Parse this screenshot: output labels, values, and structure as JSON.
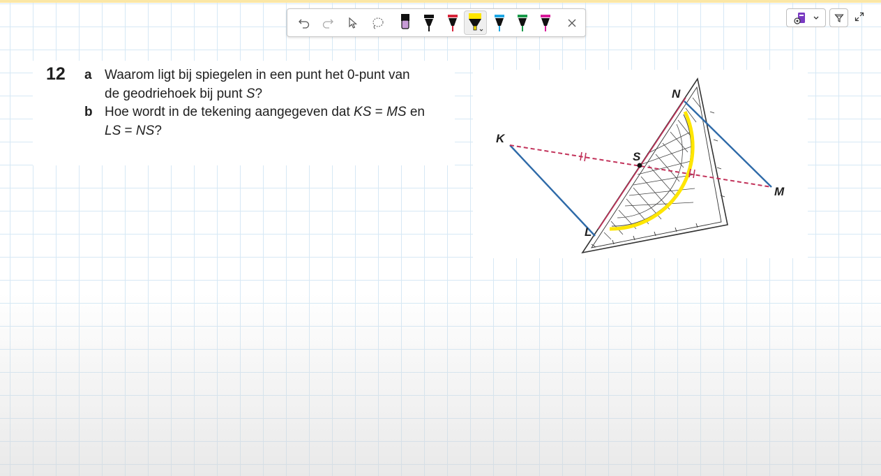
{
  "colors": {
    "grid_line": "#d6e8f5",
    "ink_blue_line": "#2e6aa8",
    "ink_dashed": "#c2325a",
    "highlighter": "#ffe600"
  },
  "toolbar": {
    "tools": [
      {
        "name": "undo",
        "icon": "undo-icon"
      },
      {
        "name": "redo",
        "icon": "redo-icon"
      },
      {
        "name": "select",
        "icon": "cursor-icon"
      },
      {
        "name": "lasso",
        "icon": "lasso-icon"
      },
      {
        "name": "pen-violet",
        "icon": "pen-icon",
        "color": "#c79bd6"
      },
      {
        "name": "pen-black",
        "icon": "pen-icon",
        "color": "#111111"
      },
      {
        "name": "pen-red",
        "icon": "pen-icon",
        "color": "#d8243a"
      },
      {
        "name": "highlighter-yellow",
        "icon": "highlighter-icon",
        "color": "#ffe600",
        "selected": true
      },
      {
        "name": "pen-blue",
        "icon": "pen-icon",
        "color": "#1ea7e4"
      },
      {
        "name": "pen-green",
        "icon": "pen-icon",
        "color": "#1a9a4a"
      },
      {
        "name": "pen-magenta",
        "icon": "pen-icon",
        "color": "#d81b9a"
      },
      {
        "name": "close",
        "icon": "close-icon"
      }
    ]
  },
  "top_right": {
    "app_icon": "onenote-app-icon",
    "filter_icon": "funnel-icon",
    "expand_icon": "expand-icon"
  },
  "question": {
    "number": "12",
    "a_label": "a",
    "a_line1": "Waarom ligt bij spiegelen in een punt het 0-punt van",
    "a_line2_prefix": "de geodriehoek bij punt ",
    "a_line2_var": "S",
    "a_line2_suffix": "?",
    "b_label": "b",
    "b_line1_prefix": "Hoe wordt in de tekening aangegeven dat ",
    "b_var1": "KS",
    "b_eq1": " = ",
    "b_var2": "MS",
    "b_line1_suffix": " en",
    "b_var3": "LS",
    "b_eq2": " = ",
    "b_var4": "NS",
    "b_line2_suffix": "?"
  },
  "figure": {
    "labels": {
      "K": "K",
      "S": "S",
      "N": "N",
      "M": "M",
      "L": "L"
    }
  }
}
